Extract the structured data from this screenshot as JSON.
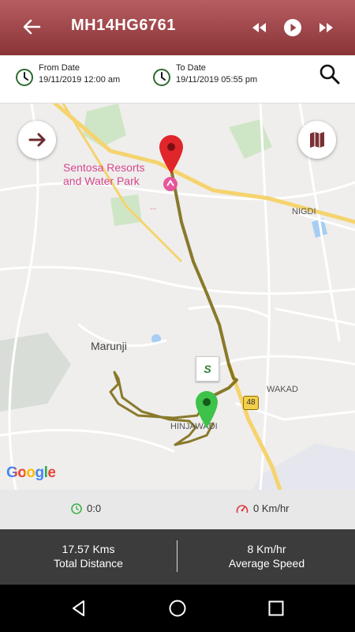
{
  "header": {
    "title": "MH14HG6761",
    "back_icon": "arrow-left-icon",
    "rewind_icon": "rewind-icon",
    "play_icon": "play-icon",
    "fast_forward_icon": "fast-forward-icon"
  },
  "dates": {
    "from_label": "From Date",
    "from_value": "19/11/2019 12:00 am",
    "to_label": "To Date",
    "to_value": "19/11/2019 05:55 pm"
  },
  "map": {
    "poi_name_line1": "Sentosa Resorts",
    "poi_name_line2": "and Water Park",
    "poi_dots": "...",
    "place_marunji": "Marunji",
    "place_nigdi": "NIGDI",
    "place_wakad": "WAKAD",
    "place_hinjawadi": "HINJAWADI",
    "road_shield": "48",
    "start_marker_label": "S",
    "google_logo": "Google",
    "colors": {
      "route": "#7d6b16",
      "start_marker": "#3fc24a",
      "end_marker": "#e0262b",
      "major_road": "#f5d36e"
    }
  },
  "stats": {
    "duration": "0:0",
    "current_speed": "0 Km/hr"
  },
  "summary": {
    "distance_value": "17.57 Kms",
    "distance_label": "Total Distance",
    "speed_value": "8 Km/hr",
    "speed_label": "Average Speed"
  }
}
